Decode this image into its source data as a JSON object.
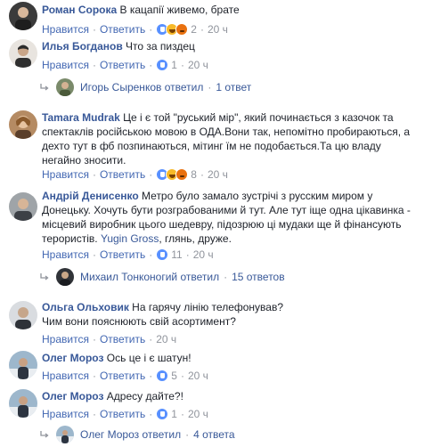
{
  "common": {
    "like": "Нравится",
    "reply": "Ответить",
    "sep": "·"
  },
  "comments": [
    {
      "author": "Роман Сорока",
      "text": "В кацапії живемо, брате",
      "reactions": [
        "like",
        "haha",
        "angry"
      ],
      "count": "2",
      "time": "20 ч"
    },
    {
      "author": "Илья Богданов",
      "text": "Что за пиздец",
      "reactions": [
        "like"
      ],
      "count": "1",
      "time": "20 ч",
      "replies": {
        "name": "Игорь Сыренков",
        "action": "ответил",
        "count": "1 ответ"
      }
    },
    {
      "author": "Tamara Mudrak",
      "text": "Це і є той \"руський мір\", який починається з казочок та спектаклів російською мовою в ОДА.Вони так, непомітно пробираються, а дехто тут в фб позпинаються, мітинг їм не подобається.Та цю владу негайно зносити.",
      "reactions": [
        "like",
        "haha",
        "angry"
      ],
      "count": "8",
      "time": "20 ч"
    },
    {
      "author": "Андрій Денисенко",
      "text_before": "Метро було замало зустрічі з русским миром у Донецьку. Хочуть бути розграбованими й тут. Але тут іще одна цікавинка - місцевий виробник цього шедевру, підозрюю ці мудаки ще й фінансують терористів.",
      "mention": "Yugin Gross",
      "text_after": ", глянь, друже.",
      "reactions": [
        "like"
      ],
      "count": "11",
      "time": "20 ч",
      "replies": {
        "name": "Михаил Тонконогий",
        "action": "ответил",
        "count": "15 ответов"
      }
    },
    {
      "author": "Ольга Ольховик",
      "text": "На гарячу лінію телефонував? Чим вони пояснюють свій асортимент?",
      "time": "20 ч"
    },
    {
      "author": "Олег Мороз",
      "text": "Ось це і є шатун!",
      "reactions": [
        "like"
      ],
      "count": "5",
      "time": "20 ч"
    },
    {
      "author": "Олег Мороз",
      "text": "Адресу дайте?!",
      "reactions": [
        "like"
      ],
      "count": "1",
      "time": "20 ч",
      "replies": {
        "name": "Олег Мороз",
        "action": "ответил",
        "count": "4 ответа"
      }
    }
  ]
}
